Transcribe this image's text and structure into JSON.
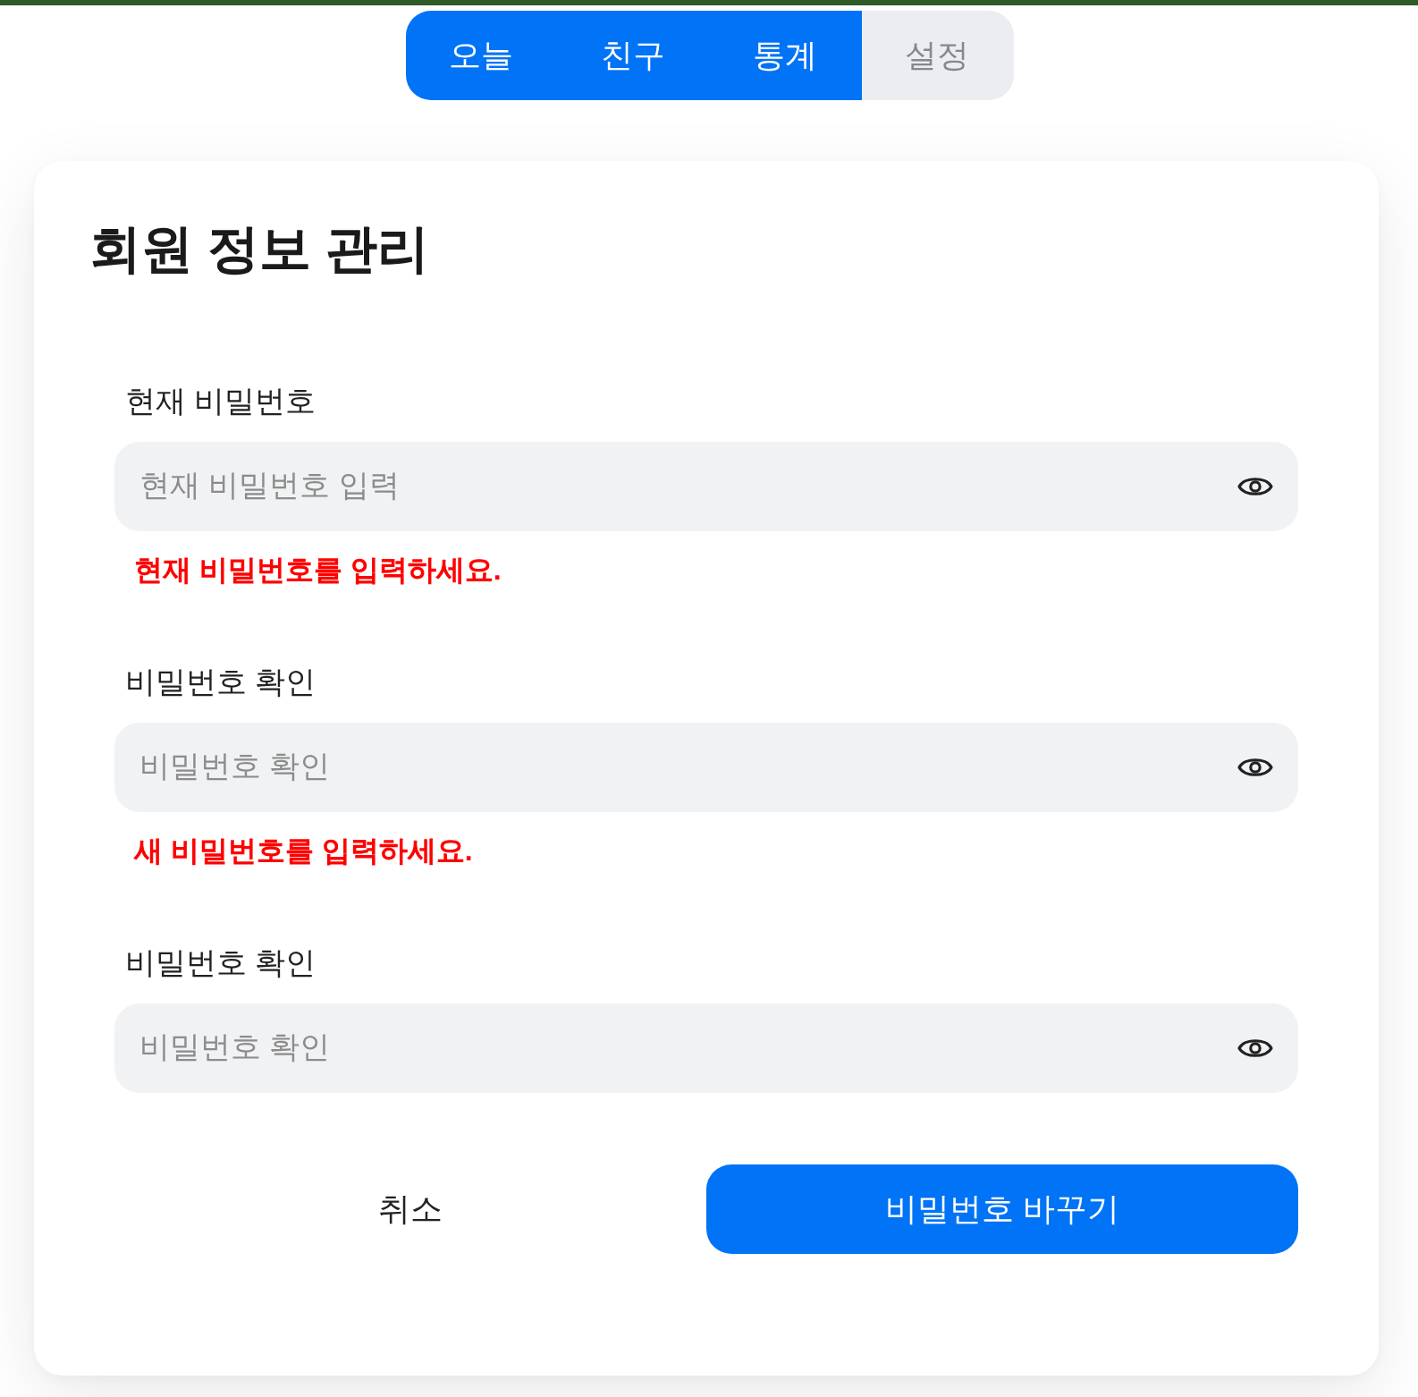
{
  "tabs": [
    {
      "label": "오늘",
      "selected": true
    },
    {
      "label": "친구",
      "selected": true
    },
    {
      "label": "통계",
      "selected": true
    },
    {
      "label": "설정",
      "selected": false
    }
  ],
  "card": {
    "title": "회원 정보 관리",
    "fields": [
      {
        "label": "현재 비밀번호",
        "placeholder": "현재 비밀번호 입력",
        "error": "현재 비밀번호를 입력하세요."
      },
      {
        "label": "비밀번호 확인",
        "placeholder": "비밀번호 확인",
        "error": "새 비밀번호를 입력하세요."
      },
      {
        "label": "비밀번호 확인",
        "placeholder": "비밀번호 확인"
      }
    ],
    "buttons": [
      {
        "label": "취소",
        "kind": "secondary"
      },
      {
        "label": "비밀번호 바꾸기",
        "kind": "primary"
      }
    ]
  }
}
